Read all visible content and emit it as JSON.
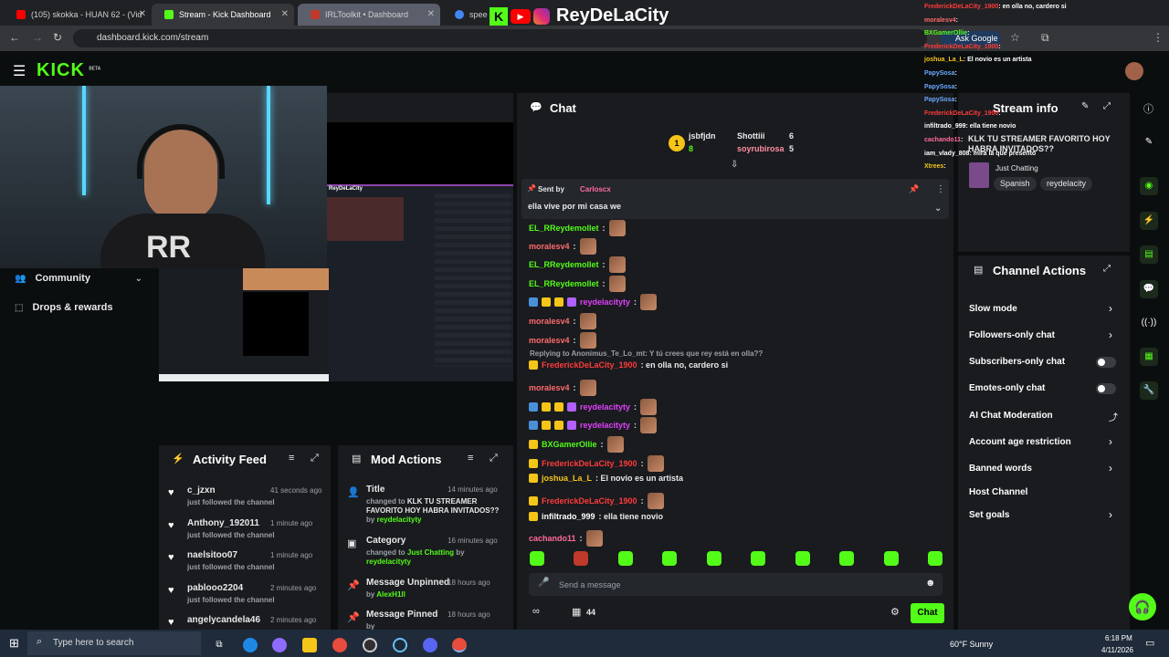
{
  "browser": {
    "tabs": [
      {
        "title": "(105) skokka - HUAN 62 - (Vid",
        "color": "#ff0000"
      },
      {
        "title": "Stream - Kick Dashboard",
        "color": "#53fc18"
      },
      {
        "title": "IRLToolkit • Dashboard",
        "color": "#c0392b"
      },
      {
        "title": "speed t",
        "color": "#4285f4"
      }
    ],
    "url": "dashboard.kick.com/stream",
    "ask_google": "Ask Google"
  },
  "overlay": {
    "brand": "ReyDeLaCity",
    "chat_lines": [
      {
        "user": "FrederickDeLaCity_1900",
        "msg": ": en olla no, cardero si",
        "color": "#ff3b3b"
      },
      {
        "user": "moralesv4",
        "msg": ":",
        "color": "#ff6b6b"
      },
      {
        "user": "BXGamerOllie",
        "msg": ":",
        "color": "#53fc18"
      },
      {
        "user": "FrederickDeLaCity_1900",
        "msg": ":",
        "color": "#ff3b3b"
      },
      {
        "user": "joshua_La_L",
        "msg": ": El novio es un artista",
        "color": "#f5c518"
      },
      {
        "user": "PapySosa",
        "msg": ":",
        "color": "#6aa9ff"
      },
      {
        "user": "PapySosa",
        "msg": ":",
        "color": "#6aa9ff"
      },
      {
        "user": "PapySosa",
        "msg": ":",
        "color": "#6aa9ff"
      },
      {
        "user": "FrederickDeLaCity_1900",
        "msg": ":",
        "color": "#ff3b3b"
      },
      {
        "user": "infiltrado_999",
        "msg": ": ella tiene novio",
        "color": "#ffffff"
      },
      {
        "user": "cachando11",
        "msg": ":",
        "color": "#ff6b9d"
      },
      {
        "user": "iam_vlady_808",
        "msg": ": mira la que presento",
        "color": "#ffffff"
      },
      {
        "user": "Xtrees",
        "msg": ":",
        "color": "#f5c518"
      }
    ]
  },
  "kick": {
    "logo": "KICK",
    "logo_sup": "BETA"
  },
  "sidebar": {
    "community": "Community",
    "drops": "Drops & rewards"
  },
  "activity_feed": {
    "title": "Activity Feed",
    "items": [
      {
        "user": "c_jzxn",
        "action": "just followed the channel",
        "time": "41 seconds ago"
      },
      {
        "user": "Anthony_192011",
        "action": "just followed the channel",
        "time": "1 minute ago"
      },
      {
        "user": "naelsitoo07",
        "action": "just followed the channel",
        "time": "1 minute ago"
      },
      {
        "user": "pablooo2204",
        "action": "just followed the channel",
        "time": "2 minutes ago"
      },
      {
        "user": "angelycandela46",
        "action": "",
        "time": "2 minutes ago"
      }
    ]
  },
  "mod_actions": {
    "title": "Mod Actions",
    "items": [
      {
        "title": "Title",
        "time": "14 minutes ago",
        "line1": "changed to",
        "value": "KLK TU STREAMER FAVORITO HOY HABRA INVITADOS??",
        "by": "by",
        "user": "reydelacityty"
      },
      {
        "title": "Category",
        "time": "16 minutes ago",
        "line1": "changed to",
        "value": "Just Chatting",
        "by": "by",
        "user": "reydelacityty"
      },
      {
        "title": "Message Unpinned",
        "time": "18 hours ago",
        "by": "by",
        "user": "AlexH1ll"
      },
      {
        "title": "Message Pinned",
        "time": "18 hours ago",
        "by": "by",
        "user": ""
      }
    ]
  },
  "chat": {
    "title": "Chat",
    "leaderboard": [
      {
        "name": "jsbfjdn",
        "count": "8"
      },
      {
        "name": "Shottiii",
        "count": "6"
      },
      {
        "name": "soyrubirosa",
        "count": "5"
      }
    ],
    "pinned": {
      "label": "Sent by",
      "user": "Carloscx",
      "message": "ella vive por mi casa we"
    },
    "reply_context": "Replying to Anonimus_Te_Lo_mt: Y tú crees que rey está en olla??",
    "messages": [
      {
        "user": "EL_RReydemollet",
        "text": ":",
        "color": "#53fc18",
        "emote": true
      },
      {
        "user": "moralesv4",
        "text": ":",
        "color": "#ff6b6b",
        "emote": true
      },
      {
        "user": "EL_RReydemollet",
        "text": ":",
        "color": "#53fc18",
        "emote": true
      },
      {
        "user": "EL_RReydemollet",
        "text": ":",
        "color": "#53fc18",
        "emote": true
      },
      {
        "user": "reydelacityty",
        "text": ":",
        "color": "#e040fb",
        "emote": true
      },
      {
        "user": "moralesv4",
        "text": ":",
        "color": "#ff6b6b",
        "emote": true
      },
      {
        "user": "moralesv4",
        "text": ":",
        "color": "#ff6b6b",
        "emote": true
      },
      {
        "user": "FrederickDeLaCity_1900",
        "text": ": en olla no, cardero si",
        "color": "#ff3b3b",
        "emote": false
      },
      {
        "user": "moralesv4",
        "text": ":",
        "color": "#ff6b6b",
        "emote": true
      },
      {
        "user": "reydelacityty",
        "text": ":",
        "color": "#e040fb",
        "emote": true
      },
      {
        "user": "reydelacityty",
        "text": ":",
        "color": "#e040fb",
        "emote": true
      },
      {
        "user": "BXGamerOllie",
        "text": ":",
        "color": "#53fc18",
        "emote": true
      },
      {
        "user": "FrederickDeLaCity_1900",
        "text": ":",
        "color": "#ff3b3b",
        "emote": true
      },
      {
        "user": "joshua_La_L",
        "text": ": El novio es un artista",
        "color": "#f5c518",
        "emote": false
      },
      {
        "user": "FrederickDeLaCity_1900",
        "text": ":",
        "color": "#ff3b3b",
        "emote": true
      },
      {
        "user": "infiltrado_999",
        "text": ": ella tiene novio",
        "color": "#ffffff",
        "emote": false
      },
      {
        "user": "cachando11",
        "text": ":",
        "color": "#ff6b9d",
        "emote": true
      }
    ],
    "input_placeholder": "Send a message",
    "viewer_count": "44",
    "chat_button": "Chat"
  },
  "stream_info": {
    "title": "Stream info",
    "stream_title": "KLK TU STREAMER FAVORITO HOY HABRA INVITADOS??",
    "category": "Just Chatting",
    "tags": [
      "Spanish",
      "reydelacity"
    ]
  },
  "channel_actions": {
    "title": "Channel Actions",
    "items": [
      {
        "label": "Slow mode",
        "control": "chevron"
      },
      {
        "label": "Followers-only chat",
        "control": "chevron"
      },
      {
        "label": "Subscribers-only chat",
        "control": "toggle"
      },
      {
        "label": "Emotes-only chat",
        "control": "toggle"
      },
      {
        "label": "AI Chat Moderation",
        "control": "external"
      },
      {
        "label": "Account age restriction",
        "control": "chevron"
      },
      {
        "label": "Banned words",
        "control": "chevron"
      },
      {
        "label": "Host Channel",
        "control": "none"
      },
      {
        "label": "Set goals",
        "control": "chevron"
      }
    ]
  },
  "taskbar": {
    "search_placeholder": "Type here to search",
    "weather": "60°F  Sunny",
    "time": "6:18 PM",
    "date": "4/11/2026"
  },
  "colors": {
    "accent": "#53fc18",
    "panel": "#191b1f",
    "bg": "#0b0e0f"
  }
}
